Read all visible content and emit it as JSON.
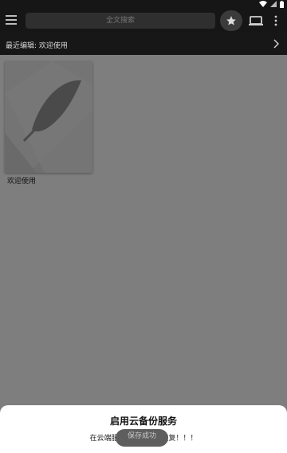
{
  "status_bar": {
    "icons": [
      "wifi-icon",
      "signal-icon",
      "battery-icon"
    ]
  },
  "toolbar": {
    "search_placeholder": "全文搜索",
    "icons": [
      "menu-icon",
      "star-icon",
      "laptop-icon",
      "more-vert-icon"
    ]
  },
  "recent_bar": {
    "label": "最近编辑: 欢迎使用"
  },
  "notes": [
    {
      "title": "欢迎使用"
    }
  ],
  "bottom_sheet": {
    "title": "启用云备份服务",
    "text": "在云端服务备份，随时恢复！！！"
  },
  "toast": {
    "text": "保存成功"
  },
  "colors": {
    "dim_overlay": "#7e7e7e",
    "toolbar_bg": "#161616",
    "search_bg": "#2f2f2f",
    "sheet_bg": "#ffffff"
  }
}
